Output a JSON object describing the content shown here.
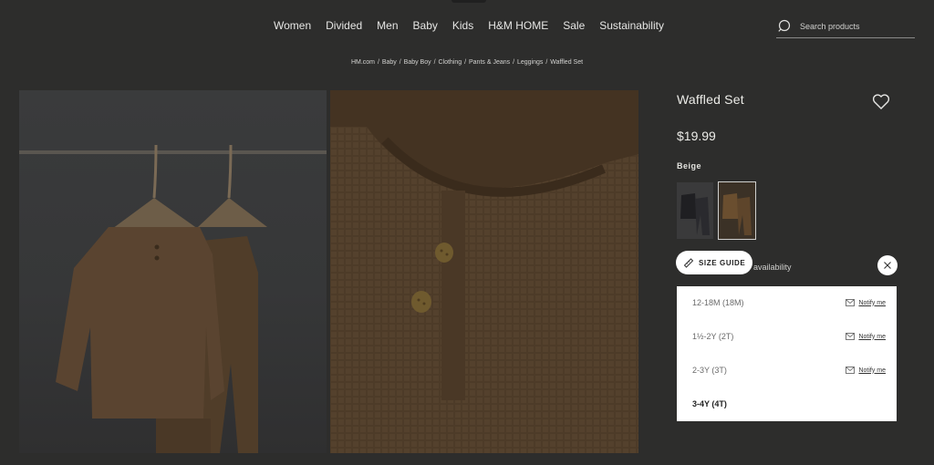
{
  "nav": {
    "items": [
      "Women",
      "Divided",
      "Men",
      "Baby",
      "Kids",
      "H&M HOME",
      "Sale",
      "Sustainability"
    ]
  },
  "search": {
    "placeholder": "Search products"
  },
  "breadcrumb": [
    "HM.com",
    "Baby",
    "Baby Boy",
    "Clothing",
    "Pants & Jeans",
    "Leggings",
    "Waffled Set"
  ],
  "product": {
    "title": "Waffled Set",
    "price": "$19.99",
    "color_label": "Beige"
  },
  "sizes": {
    "guide_label": "SIZE GUIDE",
    "availability_text": "availability",
    "options": [
      {
        "label": "12-18M (18M)",
        "notify": "Notify me"
      },
      {
        "label": "1½-2Y (2T)",
        "notify": "Notify me"
      },
      {
        "label": "2-3Y (3T)",
        "notify": "Notify me"
      },
      {
        "label": "3-4Y (4T)",
        "notify": ""
      }
    ]
  },
  "colors": {
    "background": "#2d2d2c",
    "panel": "#ffffff",
    "product_brown": "#4b3a28"
  }
}
